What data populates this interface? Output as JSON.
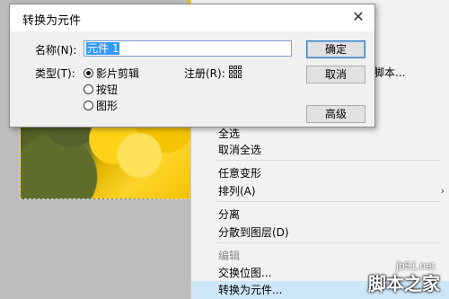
{
  "dialog": {
    "title": "转换为元件",
    "name_label": "名称(N):",
    "name_value": "元件 1",
    "type_label": "类型(T):",
    "type_options": [
      "影片剪辑",
      "按钮",
      "图形"
    ],
    "registration_label": "注册(R):",
    "buttons": {
      "ok": "确定",
      "cancel": "取消",
      "advanced": "高级"
    }
  },
  "context_menu": {
    "partial_script_text": "脚本...",
    "items": [
      {
        "label": "全选",
        "enabled": true
      },
      {
        "label": "取消全选",
        "enabled": true
      },
      {
        "label": "任意变形",
        "enabled": true
      },
      {
        "label": "排列(A)",
        "enabled": true,
        "submenu": true
      },
      {
        "label": "分离",
        "enabled": true
      },
      {
        "label": "分散到图层(D)",
        "enabled": true
      },
      {
        "label": "编辑",
        "enabled": false
      },
      {
        "label": "交换位图...",
        "enabled": true
      },
      {
        "label": "转换为元件...",
        "enabled": true,
        "highlighted": true
      }
    ]
  },
  "watermark": {
    "url": "jb51.net",
    "name": "脚本之家"
  }
}
